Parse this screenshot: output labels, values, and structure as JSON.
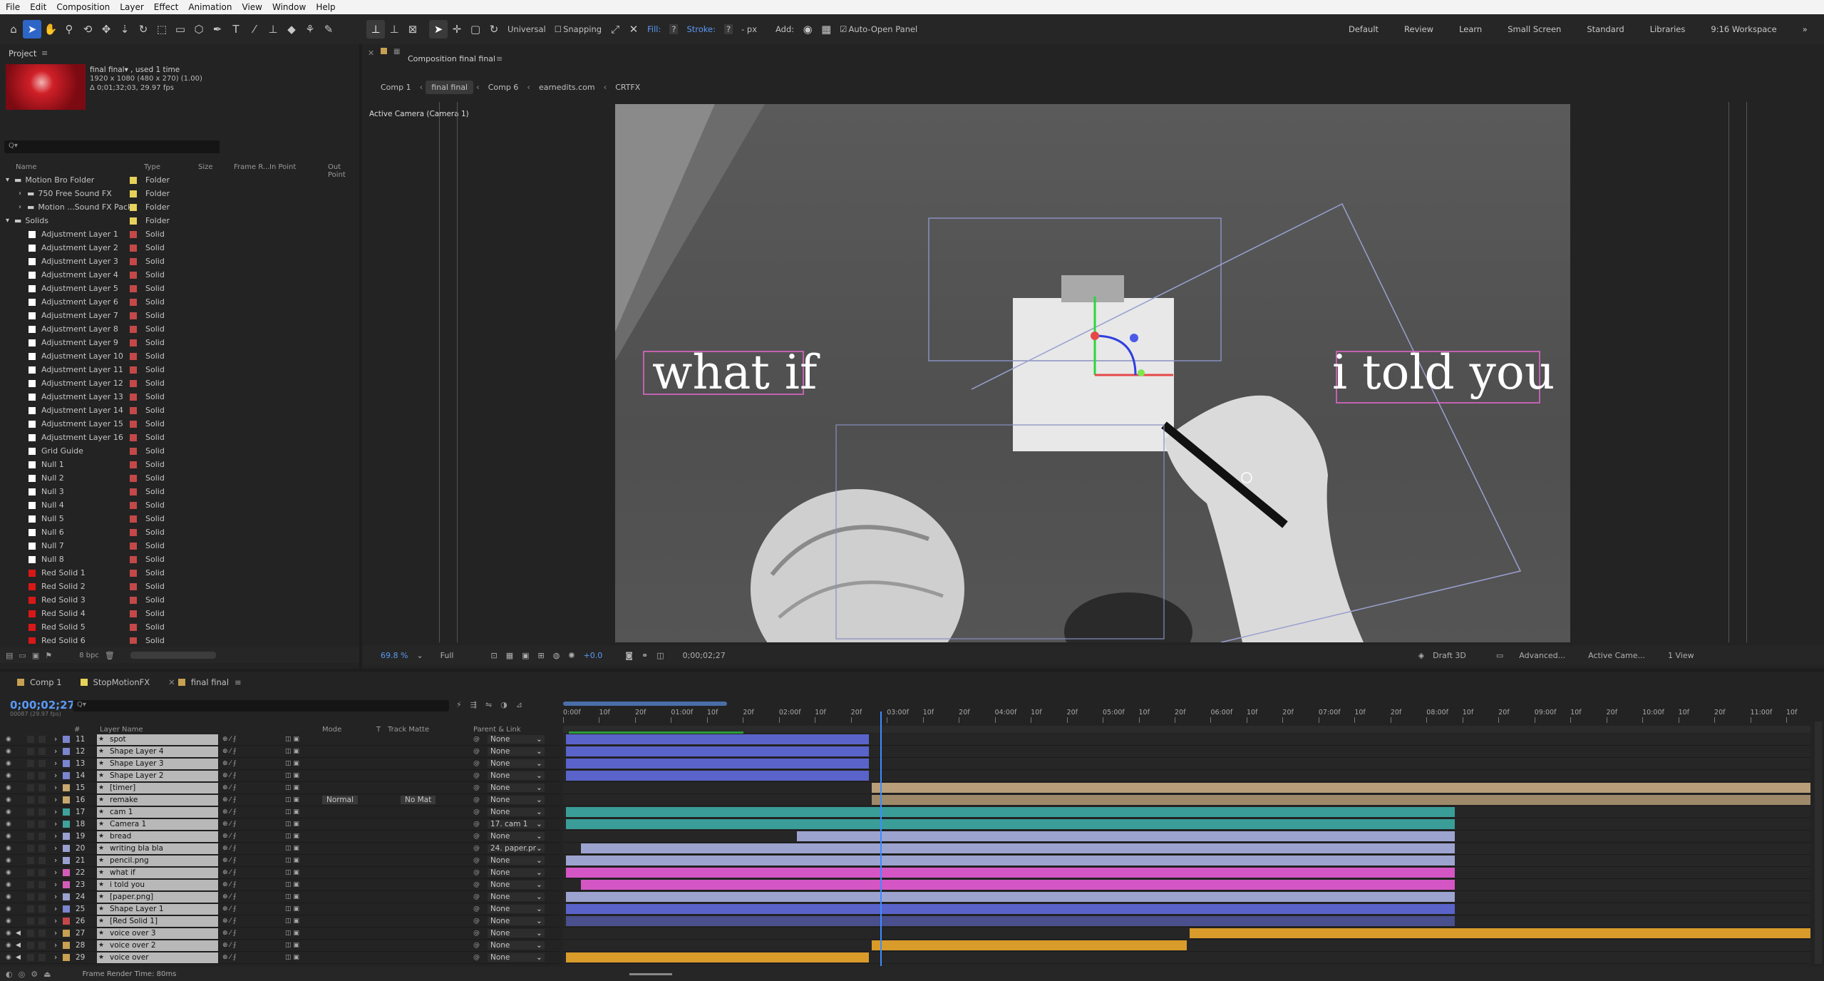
{
  "menu": [
    "File",
    "Edit",
    "Composition",
    "Layer",
    "Effect",
    "Animation",
    "View",
    "Window",
    "Help"
  ],
  "toolbar": {
    "universal": "Universal",
    "snapping": "Snapping",
    "fill": "Fill:",
    "fill_val": "?",
    "stroke": "Stroke:",
    "stroke_val": "?",
    "stroke_px": "- px",
    "add": "Add:",
    "auto_open": "Auto-Open Panel"
  },
  "workspaces": [
    "Default",
    "Review",
    "Learn",
    "Small Screen",
    "Standard",
    "Libraries",
    "9:16 Workspace"
  ],
  "project": {
    "title": "Project",
    "item_name": "final final▾ , used 1 time",
    "item_res": "1920 x 1080 (480 x 270) (1.00)",
    "item_dur": "Δ 0;01;32;03, 29.97 fps",
    "search_placeholder": "Q▾",
    "headers": {
      "name": "Name",
      "type": "Type",
      "size": "Size",
      "frame": "Frame R...",
      "in": "In Point",
      "out": "Out Point"
    },
    "rows": [
      {
        "name": "Motion Bro Folder",
        "type": "Folder",
        "color": "#e6d25a",
        "indent": 0,
        "kind": "folder"
      },
      {
        "name": "750 Free Sound FX",
        "type": "Folder",
        "color": "#e6d25a",
        "indent": 1,
        "kind": "folder"
      },
      {
        "name": "Motion ...Sound FX Pack",
        "type": "Folder",
        "color": "#e6d25a",
        "indent": 1,
        "kind": "folder"
      },
      {
        "name": "Solids",
        "type": "Folder",
        "color": "#e6d25a",
        "indent": 0,
        "kind": "folder"
      },
      {
        "name": "Adjustment Layer 1",
        "type": "Solid",
        "color": "#c44848",
        "indent": 2,
        "kind": "white"
      },
      {
        "name": "Adjustment Layer 2",
        "type": "Solid",
        "color": "#c44848",
        "indent": 2,
        "kind": "white"
      },
      {
        "name": "Adjustment Layer 3",
        "type": "Solid",
        "color": "#c44848",
        "indent": 2,
        "kind": "white"
      },
      {
        "name": "Adjustment Layer 4",
        "type": "Solid",
        "color": "#c44848",
        "indent": 2,
        "kind": "white"
      },
      {
        "name": "Adjustment Layer 5",
        "type": "Solid",
        "color": "#c44848",
        "indent": 2,
        "kind": "white"
      },
      {
        "name": "Adjustment Layer 6",
        "type": "Solid",
        "color": "#c44848",
        "indent": 2,
        "kind": "white"
      },
      {
        "name": "Adjustment Layer 7",
        "type": "Solid",
        "color": "#c44848",
        "indent": 2,
        "kind": "white"
      },
      {
        "name": "Adjustment Layer 8",
        "type": "Solid",
        "color": "#c44848",
        "indent": 2,
        "kind": "white"
      },
      {
        "name": "Adjustment Layer 9",
        "type": "Solid",
        "color": "#c44848",
        "indent": 2,
        "kind": "white"
      },
      {
        "name": "Adjustment Layer 10",
        "type": "Solid",
        "color": "#c44848",
        "indent": 2,
        "kind": "white"
      },
      {
        "name": "Adjustment Layer 11",
        "type": "Solid",
        "color": "#c44848",
        "indent": 2,
        "kind": "white"
      },
      {
        "name": "Adjustment Layer 12",
        "type": "Solid",
        "color": "#c44848",
        "indent": 2,
        "kind": "white"
      },
      {
        "name": "Adjustment Layer 13",
        "type": "Solid",
        "color": "#c44848",
        "indent": 2,
        "kind": "white"
      },
      {
        "name": "Adjustment Layer 14",
        "type": "Solid",
        "color": "#c44848",
        "indent": 2,
        "kind": "white"
      },
      {
        "name": "Adjustment Layer 15",
        "type": "Solid",
        "color": "#c44848",
        "indent": 2,
        "kind": "white"
      },
      {
        "name": "Adjustment Layer 16",
        "type": "Solid",
        "color": "#c44848",
        "indent": 2,
        "kind": "white"
      },
      {
        "name": "Grid Guide",
        "type": "Solid",
        "color": "#c44848",
        "indent": 2,
        "kind": "white"
      },
      {
        "name": "Null 1",
        "type": "Solid",
        "color": "#c44848",
        "indent": 2,
        "kind": "white"
      },
      {
        "name": "Null 2",
        "type": "Solid",
        "color": "#c44848",
        "indent": 2,
        "kind": "white"
      },
      {
        "name": "Null 3",
        "type": "Solid",
        "color": "#c44848",
        "indent": 2,
        "kind": "white"
      },
      {
        "name": "Null 4",
        "type": "Solid",
        "color": "#c44848",
        "indent": 2,
        "kind": "white"
      },
      {
        "name": "Null 5",
        "type": "Solid",
        "color": "#c44848",
        "indent": 2,
        "kind": "white"
      },
      {
        "name": "Null 6",
        "type": "Solid",
        "color": "#c44848",
        "indent": 2,
        "kind": "white"
      },
      {
        "name": "Null 7",
        "type": "Solid",
        "color": "#c44848",
        "indent": 2,
        "kind": "white"
      },
      {
        "name": "Null 8",
        "type": "Solid",
        "color": "#c44848",
        "indent": 2,
        "kind": "white"
      },
      {
        "name": "Red Solid 1",
        "type": "Solid",
        "color": "#c44848",
        "indent": 2,
        "kind": "red"
      },
      {
        "name": "Red Solid 2",
        "type": "Solid",
        "color": "#c44848",
        "indent": 2,
        "kind": "red"
      },
      {
        "name": "Red Solid 3",
        "type": "Solid",
        "color": "#c44848",
        "indent": 2,
        "kind": "red"
      },
      {
        "name": "Red Solid 4",
        "type": "Solid",
        "color": "#c44848",
        "indent": 2,
        "kind": "red"
      },
      {
        "name": "Red Solid 5",
        "type": "Solid",
        "color": "#c44848",
        "indent": 2,
        "kind": "red"
      },
      {
        "name": "Red Solid 6",
        "type": "Solid",
        "color": "#c44848",
        "indent": 2,
        "kind": "red"
      }
    ],
    "bpc": "8 bpc"
  },
  "composition": {
    "tab": "Composition final final",
    "breadcrumbs": [
      "Comp 1",
      "final final",
      "Comp 6",
      "earnedits.com",
      "CRTFX"
    ],
    "camera_label": "Active Camera (Camera 1)",
    "text_left": "what if",
    "text_right": "i told you",
    "zoom": "69.8 %",
    "resolution": "Full",
    "exposure": "+0.0",
    "timecode": "0;00;02;27",
    "renderer": "Draft 3D",
    "advanced": "Advanced...",
    "camera": "Active Came...",
    "views": "1 View"
  },
  "timeline": {
    "tabs": [
      "Comp 1",
      "StopMotionFX",
      "final final"
    ],
    "tab_colors": [
      "#c8a052",
      "#e6d25a",
      "#c8a052"
    ],
    "timecode": "0;00;02;27",
    "subcode": "00087 (29.97 fps)",
    "search_placeholder": "Q▾",
    "headers": {
      "num": "#",
      "layer_name": "Layer Name",
      "mode": "Mode",
      "t": "T",
      "track_matte": "Track Matte",
      "parent": "Parent & Link"
    },
    "ruler": [
      "0:00f",
      "10f",
      "20f",
      "01:00f",
      "10f",
      "20f",
      "02:00f",
      "10f",
      "20f",
      "03:00f",
      "10f",
      "20f",
      "04:00f",
      "10f",
      "20f",
      "05:00f",
      "10f",
      "20f",
      "06:00f",
      "10f",
      "20f",
      "07:00f",
      "10f",
      "20f",
      "08:00f",
      "10f",
      "20f",
      "09:00f",
      "10f",
      "20f",
      "10:00f",
      "10f",
      "20f",
      "11:00f",
      "10f"
    ],
    "layers": [
      {
        "num": "11",
        "name": "spot",
        "label": "#7b86cf",
        "parent": "None",
        "bar": [
          0,
          0.245
        ],
        "bar_color": "#5a63c9"
      },
      {
        "num": "12",
        "name": "Shape Layer 4",
        "label": "#7b86cf",
        "parent": "None",
        "bar": [
          0,
          0.245
        ],
        "bar_color": "#5a63c9"
      },
      {
        "num": "13",
        "name": "Shape Layer 3",
        "label": "#7b86cf",
        "parent": "None",
        "bar": [
          0,
          0.245
        ],
        "bar_color": "#5a63c9"
      },
      {
        "num": "14",
        "name": "Shape Layer 2",
        "label": "#7b86cf",
        "parent": "None",
        "bar": [
          0,
          0.245
        ],
        "bar_color": "#5a63c9"
      },
      {
        "num": "15",
        "name": "[timer]",
        "label": "#c8a86e",
        "parent": "None",
        "bar": [
          0.245,
          1
        ],
        "bar_color": "#b89f79"
      },
      {
        "num": "16",
        "name": "remake",
        "label": "#c8a86e",
        "parent": "None",
        "mode": "Normal",
        "matte": "No Mat",
        "bar": [
          0.245,
          1
        ],
        "bar_color": "#9e8a6a"
      },
      {
        "num": "17",
        "name": "cam 1",
        "label": "#3fa39c",
        "parent": "None",
        "bar": [
          0,
          0.715
        ],
        "bar_color": "#3a9d97"
      },
      {
        "num": "18",
        "name": "Camera 1",
        "label": "#3fa39c",
        "parent": "17. cam 1",
        "bar": [
          0,
          0.715
        ],
        "bar_color": "#3a9d97"
      },
      {
        "num": "19",
        "name": "bread",
        "label": "#9aa0cf",
        "parent": "None",
        "bar": [
          0.185,
          0.715
        ],
        "bar_color": "#9da3cf"
      },
      {
        "num": "20",
        "name": "writing bla bla",
        "label": "#9aa0cf",
        "parent": "24. paper.pr",
        "bar": [
          0.012,
          0.715
        ],
        "bar_color": "#9da3cf"
      },
      {
        "num": "21",
        "name": "pencil.png",
        "label": "#9aa0cf",
        "parent": "None",
        "bar": [
          0,
          0.715
        ],
        "bar_color": "#9da3cf"
      },
      {
        "num": "22",
        "name": "what if",
        "label": "#d45cb9",
        "parent": "None",
        "bar": [
          0,
          0.715
        ],
        "bar_color": "#d456c4"
      },
      {
        "num": "23",
        "name": "i told you",
        "label": "#d45cb9",
        "parent": "None",
        "bar": [
          0.012,
          0.715
        ],
        "bar_color": "#d456c4"
      },
      {
        "num": "24",
        "name": "[paper.png]",
        "label": "#9aa0cf",
        "parent": "None",
        "bar": [
          0,
          0.715
        ],
        "bar_color": "#9da3cf"
      },
      {
        "num": "25",
        "name": "Shape Layer 1",
        "label": "#7b86cf",
        "parent": "None",
        "bar": [
          0,
          0.715
        ],
        "bar_color": "#5a63c9"
      },
      {
        "num": "26",
        "name": "[Red Solid 1]",
        "label": "#c44848",
        "parent": "None",
        "bar": [
          0,
          0.715
        ],
        "bar_color": "#4a4f8d"
      },
      {
        "num": "27",
        "name": "voice over 3",
        "label": "#c8a052",
        "parent": "None",
        "bar": [
          0.5,
          1
        ],
        "bar_color": "#d99b2a"
      },
      {
        "num": "28",
        "name": "voice over 2",
        "label": "#c8a052",
        "parent": "None",
        "bar": [
          0.245,
          0.5
        ],
        "bar_color": "#d99b2a"
      },
      {
        "num": "29",
        "name": "voice over",
        "label": "#c8a052",
        "parent": "None",
        "bar": [
          0,
          0.245
        ],
        "bar_color": "#d99b2a"
      }
    ],
    "playhead": 0.254,
    "frame_render": "Frame Render Time: 80ms"
  }
}
